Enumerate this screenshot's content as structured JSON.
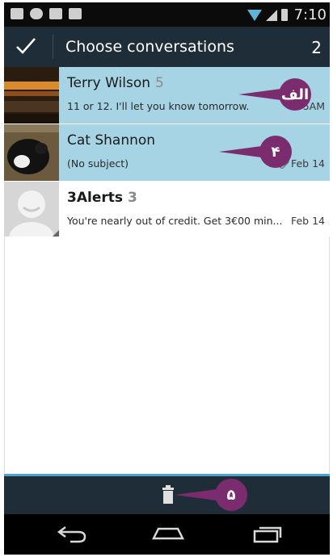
{
  "status_bar": {
    "time": "7:10"
  },
  "action_bar": {
    "title": "Choose conversations",
    "selected_count": "2"
  },
  "conversations": [
    {
      "name": "Terry Wilson",
      "count": "5",
      "snippet": "11 or 12. I'll let you know tomorrow.",
      "date": "5AM",
      "selected": true,
      "has_attachment": false
    },
    {
      "name": "Cat Shannon",
      "count": "",
      "snippet": "(No subject)",
      "date": "Feb 14",
      "selected": true,
      "has_attachment": true
    },
    {
      "name": "3Alerts",
      "count": "3",
      "snippet": "You're nearly out of credit. Get 3€00 min...",
      "date": "Feb 14",
      "selected": false,
      "has_attachment": false
    }
  ],
  "annotations": {
    "a": "الف",
    "b": "۴",
    "c": "۵"
  },
  "colors": {
    "accent": "#4aa3d1",
    "selected_row": "#a6d4e5",
    "action_bar": "#1f2d38",
    "badge": "#7b2c6e"
  }
}
